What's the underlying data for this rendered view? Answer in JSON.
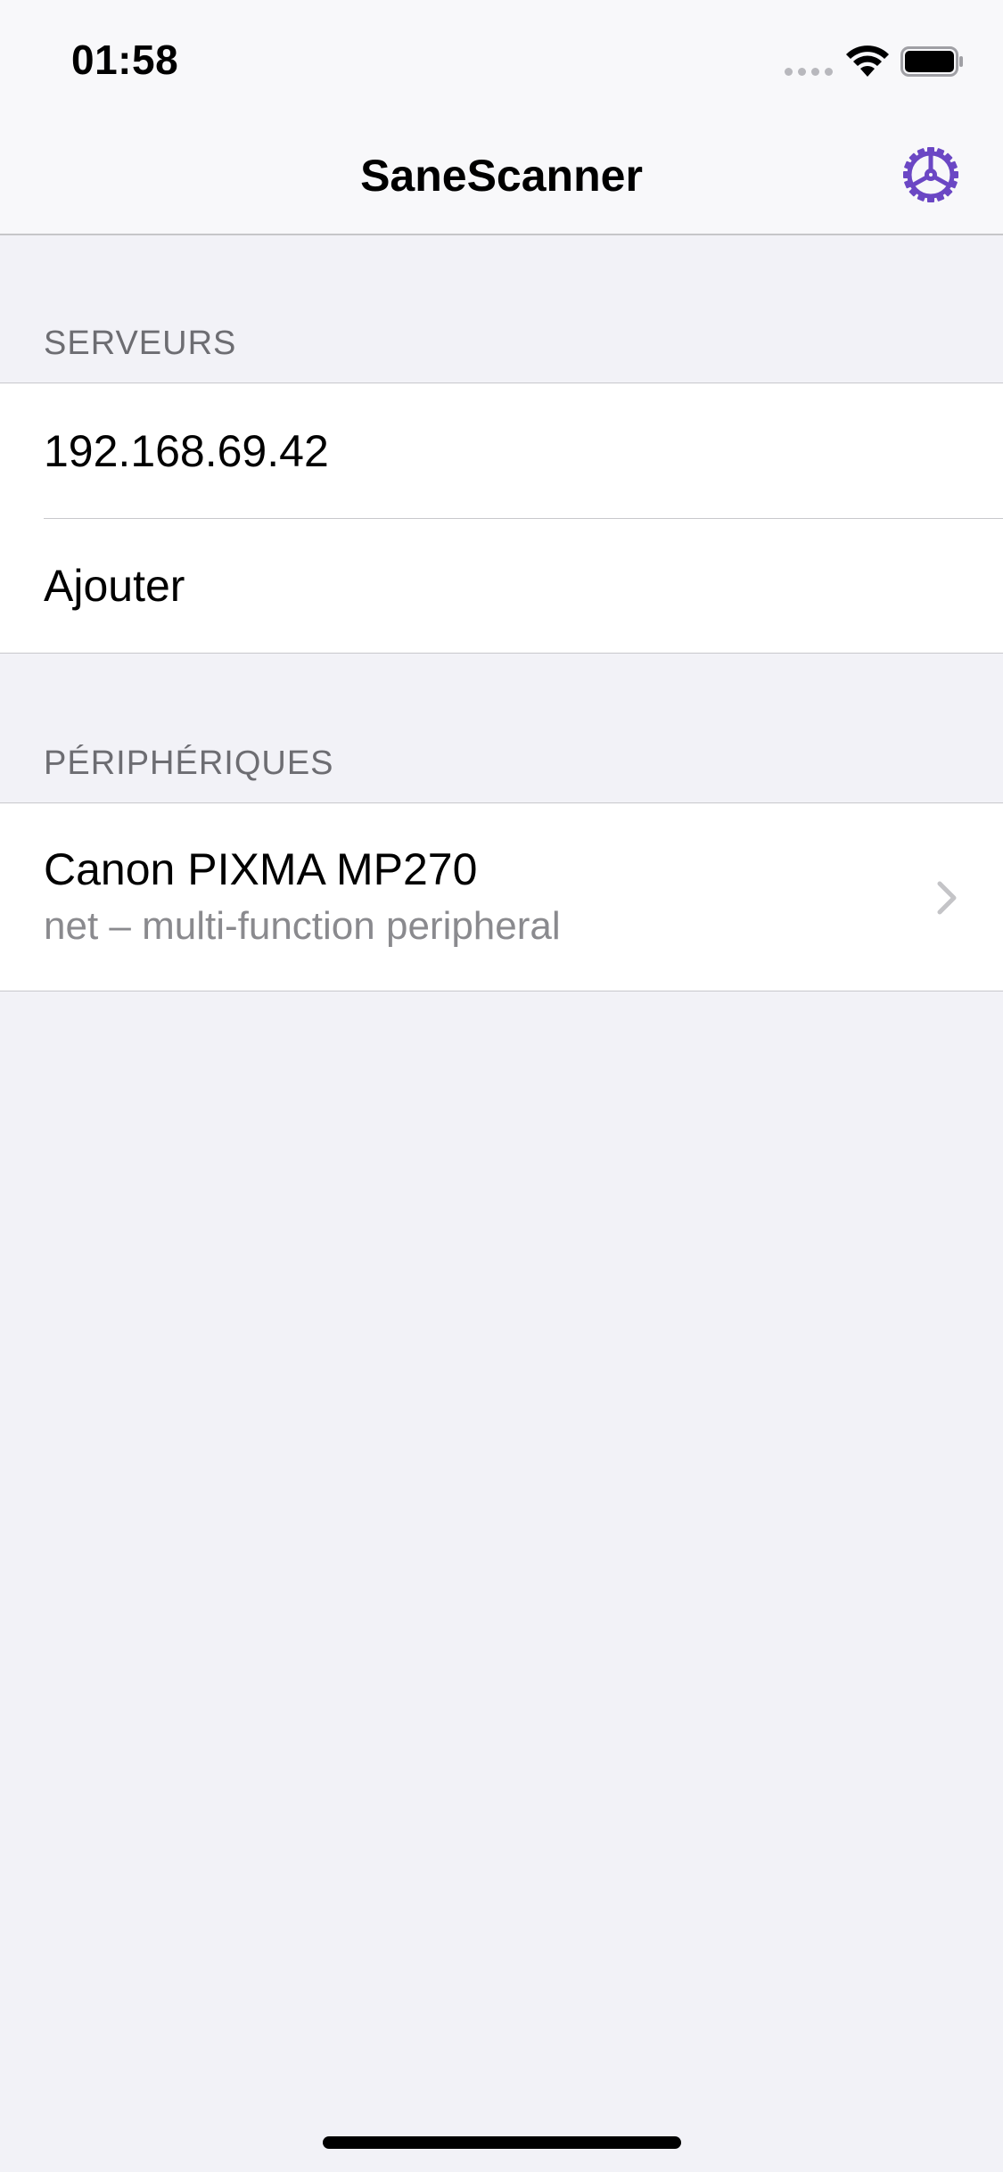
{
  "status_bar": {
    "time": "01:58"
  },
  "nav": {
    "title": "SaneScanner",
    "settings_icon": "gear-icon",
    "accent_color": "#6b47c4"
  },
  "servers": {
    "header": "SERVEURS",
    "items": [
      {
        "label": "192.168.69.42"
      },
      {
        "label": "Ajouter"
      }
    ]
  },
  "devices": {
    "header": "PÉRIPHÉRIQUES",
    "items": [
      {
        "name": "Canon PIXMA MP270",
        "subtitle": "net – multi-function peripheral"
      }
    ]
  }
}
